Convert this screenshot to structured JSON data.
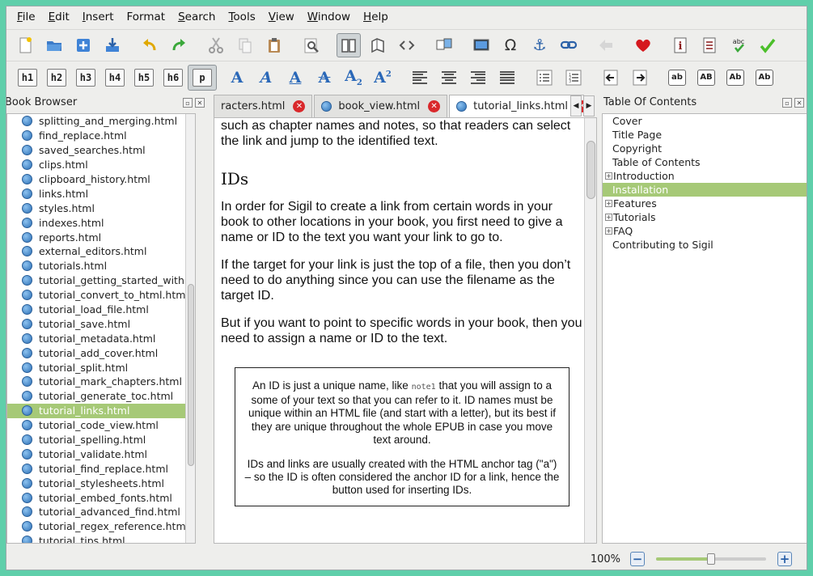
{
  "menu": [
    {
      "label": "File",
      "u": "F",
      "rest": "ile"
    },
    {
      "label": "Edit",
      "u": "E",
      "rest": "dit"
    },
    {
      "label": "Insert",
      "u": "I",
      "rest": "nsert"
    },
    {
      "label": "Format",
      "u": "",
      "rest": "Format"
    },
    {
      "label": "Search",
      "u": "S",
      "rest": "earch"
    },
    {
      "label": "Tools",
      "u": "T",
      "rest": "ools"
    },
    {
      "label": "View",
      "u": "V",
      "rest": "iew"
    },
    {
      "label": "Window",
      "u": "W",
      "rest": "indow"
    },
    {
      "label": "Help",
      "u": "H",
      "rest": "elp"
    }
  ],
  "heading_buttons": [
    "h1",
    "h2",
    "h3",
    "h4",
    "h5",
    "h6",
    "p"
  ],
  "case_buttons": [
    "ab",
    "AB",
    "Ab",
    "Ab"
  ],
  "book_browser": {
    "title": "Book Browser",
    "items": [
      "splitting_and_merging.html",
      "find_replace.html",
      "saved_searches.html",
      "clips.html",
      "clipboard_history.html",
      "links.html",
      "styles.html",
      "indexes.html",
      "reports.html",
      "external_editors.html",
      "tutorials.html",
      "tutorial_getting_started_with...",
      "tutorial_convert_to_html.html",
      "tutorial_load_file.html",
      "tutorial_save.html",
      "tutorial_metadata.html",
      "tutorial_add_cover.html",
      "tutorial_split.html",
      "tutorial_mark_chapters.html",
      "tutorial_generate_toc.html",
      "tutorial_links.html",
      "tutorial_code_view.html",
      "tutorial_spelling.html",
      "tutorial_validate.html",
      "tutorial_find_replace.html",
      "tutorial_stylesheets.html",
      "tutorial_embed_fonts.html",
      "tutorial_advanced_find.html",
      "tutorial_regex_reference.html",
      "tutorial_tips.html"
    ],
    "selected": "tutorial_links.html"
  },
  "tabs": [
    {
      "label": "racters.html",
      "active": false
    },
    {
      "label": "book_view.html",
      "active": false
    },
    {
      "label": "tutorial_links.html",
      "active": true
    }
  ],
  "editor": {
    "intro": "such as chapter names and notes, so that readers can select the link and jump to the identified text.",
    "heading": "IDs",
    "p1": "In order for Sigil to create a link from certain words in your book to other locations in your book, you first need to give a name or ID to the text you want your link to go to.",
    "p2": "If the target for your link is just the top of a file, then you don’t need to do anything since you can use the filename as the target ID.",
    "p3": "But if you want to point to specific words in your book, then you need to assign a name or ID to the text.",
    "note_before_code": "An ID is just a unique name, like ",
    "note_code": "note1",
    "note_after_code": " that you will assign to a some of your text so that you can refer to it. ID names must be unique within an HTML file (and start with a letter), but its best if they are unique throughout the whole EPUB in case you move text around.",
    "note2": "IDs and links are usually created with the HTML anchor tag (\"a\") – so the ID is often considered the anchor ID for a link, hence the button used for inserting IDs."
  },
  "toc": {
    "title": "Table Of Contents",
    "items": [
      {
        "label": "Cover",
        "expandable": false,
        "selected": false
      },
      {
        "label": "Title Page",
        "expandable": false,
        "selected": false
      },
      {
        "label": "Copyright",
        "expandable": false,
        "selected": false
      },
      {
        "label": "Table of Contents",
        "expandable": false,
        "selected": false
      },
      {
        "label": "Introduction",
        "expandable": true,
        "selected": false
      },
      {
        "label": "Installation",
        "expandable": false,
        "selected": true
      },
      {
        "label": "Features",
        "expandable": true,
        "selected": false
      },
      {
        "label": "Tutorials",
        "expandable": true,
        "selected": false
      },
      {
        "label": "FAQ",
        "expandable": true,
        "selected": false
      },
      {
        "label": "Contributing to Sigil",
        "expandable": false,
        "selected": false
      }
    ]
  },
  "status": {
    "zoom": "100%",
    "zoom_fraction": 0.5,
    "minus": "−",
    "plus": "+"
  },
  "colors": {
    "selection": "#a6c977",
    "accent": "#2b6fb6",
    "close": "#d9282b"
  }
}
